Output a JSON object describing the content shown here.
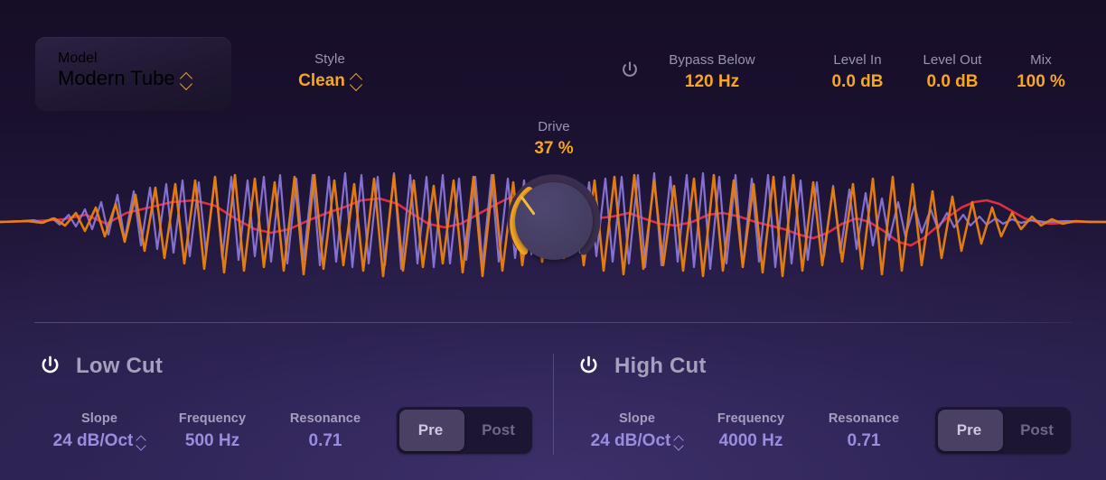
{
  "header": {
    "model": {
      "label": "Model",
      "value": "Modern Tube",
      "icon": "chevron-updown-icon"
    },
    "style": {
      "label": "Style",
      "value": "Clean",
      "icon": "chevron-updown-icon"
    },
    "bypass_power": {
      "icon": "power-icon",
      "state": "off"
    },
    "bypass_below": {
      "label": "Bypass Below",
      "value": "120 Hz"
    },
    "level_in": {
      "label": "Level In",
      "value": "0.0 dB"
    },
    "level_out": {
      "label": "Level Out",
      "value": "0.0 dB"
    },
    "mix": {
      "label": "Mix",
      "value": "100 %"
    }
  },
  "drive": {
    "label": "Drive",
    "value": "37 %",
    "percent": 37,
    "knob": "drive-knob"
  },
  "low_cut": {
    "title": "Low Cut",
    "power": {
      "icon": "power-icon",
      "state": "on"
    },
    "slope": {
      "label": "Slope",
      "value": "24 dB/Oct",
      "icon": "chevron-updown-icon"
    },
    "frequency": {
      "label": "Frequency",
      "value": "500 Hz"
    },
    "resonance": {
      "label": "Resonance",
      "value": "0.71"
    },
    "placement": {
      "options": [
        "Pre",
        "Post"
      ],
      "selected": "Pre"
    }
  },
  "high_cut": {
    "title": "High Cut",
    "power": {
      "icon": "power-icon",
      "state": "on"
    },
    "slope": {
      "label": "Slope",
      "value": "24 dB/Oct",
      "icon": "chevron-updown-icon"
    },
    "frequency": {
      "label": "Frequency",
      "value": "4000 Hz"
    },
    "resonance": {
      "label": "Resonance",
      "value": "0.71"
    },
    "placement": {
      "options": [
        "Pre",
        "Post"
      ],
      "selected": "Pre"
    }
  },
  "colors": {
    "accent_amber": "#f5a623",
    "value_purple": "#9c8ce0",
    "label_grey": "#9a95b0",
    "wave_purple": "#8f7be0",
    "wave_orange": "#e8800f",
    "wave_red": "#e8303f",
    "bg_top": "#160d27",
    "bg_bottom": "#2e2553"
  }
}
